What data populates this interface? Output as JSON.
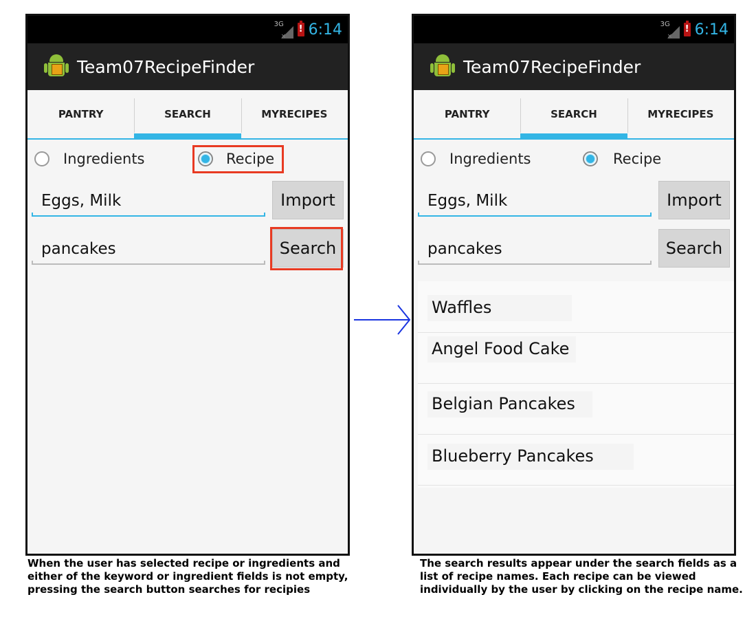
{
  "app": {
    "title": "Team07RecipeFinder",
    "clock": "6:14",
    "network": "3G",
    "accent_color": "#33b5e5",
    "actionbar_color": "#222222",
    "highlight_color": "#e83a22"
  },
  "tabs": [
    {
      "label": "PANTRY",
      "active": false
    },
    {
      "label": "SEARCH",
      "active": true
    },
    {
      "label": "MYRECIPES",
      "active": false
    }
  ],
  "search_mode": {
    "ingredients_label": "Ingredients",
    "recipe_label": "Recipe",
    "selected": "Recipe"
  },
  "ingredients_field": {
    "value": "Eggs, Milk"
  },
  "keyword_field": {
    "value": "pancakes"
  },
  "buttons": {
    "import_label": "Import",
    "search_label": "Search"
  },
  "results": [
    "Waffles",
    "Angel Food Cake",
    "Belgian Pancakes",
    "Blueberry Pancakes"
  ],
  "captions": {
    "left": "When the user has selected recipe or ingredients and either of the keyword or ingredient fields is not empty, pressing the search button searches for recipies",
    "right": "The search results appear under the search fields as a list of recipe names. Each recipe can be viewed individually by the user by clicking on the recipe name."
  },
  "icons": {
    "app": "android-robot-icon",
    "battery": "battery-alert-icon",
    "signal": "signal-3g-icon",
    "arrow": "arrow-right-icon"
  }
}
